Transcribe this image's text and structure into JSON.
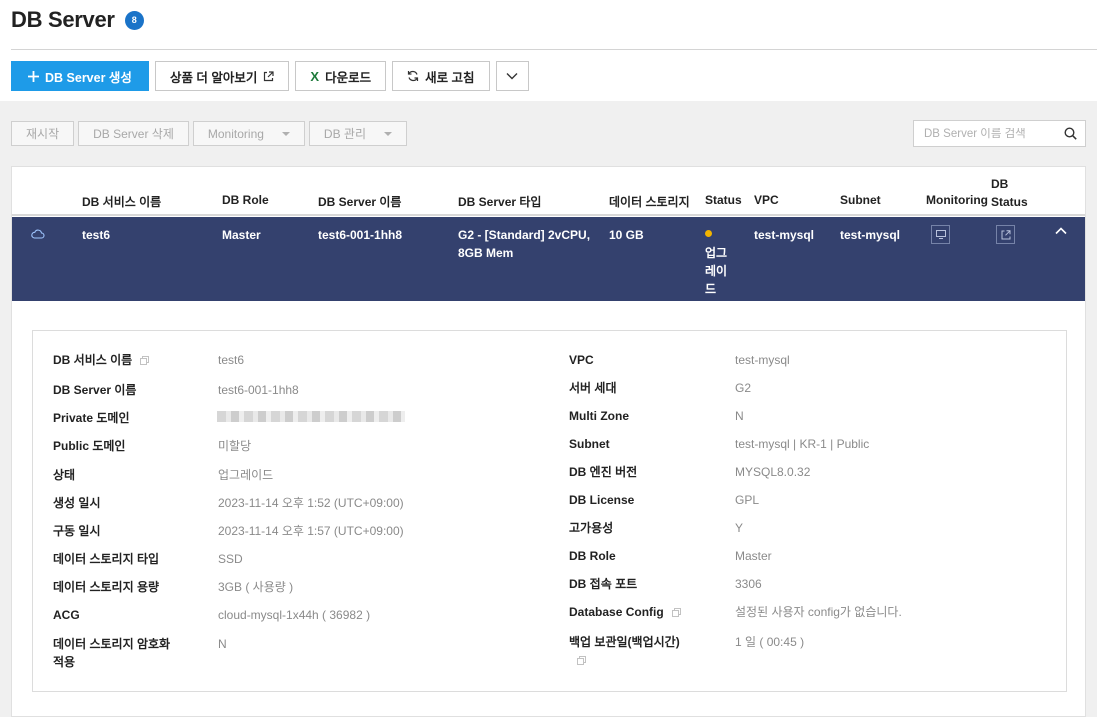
{
  "header": {
    "title": "DB Server",
    "count": "8"
  },
  "toolbar": {
    "create_label": "DB Server 생성",
    "learn_more_label": "상품 더 알아보기",
    "download_label": "다운로드",
    "refresh_label": "새로 고침"
  },
  "actions": {
    "restart": "재시작",
    "delete": "DB Server 삭제",
    "monitoring": "Monitoring",
    "db_manage": "DB 관리"
  },
  "search": {
    "placeholder": "DB Server 이름 검색"
  },
  "table": {
    "headers": {
      "service_name": "DB 서비스 이름",
      "role": "DB Role",
      "server_name": "DB Server 이름",
      "server_type": "DB Server 타입",
      "storage": "데이터 스토리지",
      "status": "Status",
      "vpc": "VPC",
      "subnet": "Subnet",
      "monitoring": "Monitoring",
      "db_status_1": "DB",
      "db_status_2": "Status"
    },
    "row": {
      "service_name": "test6",
      "role": "Master",
      "server_name": "test6-001-1hh8",
      "server_type_1": "G2 - [Standard] 2vCPU,",
      "server_type_2": "8GB Mem",
      "storage": "10 GB",
      "status_1": "업그",
      "status_2": "레이",
      "status_3": "드",
      "vpc": "test-mysql",
      "subnet": "test-mysql",
      "status_color": "#f2b400"
    }
  },
  "detail": {
    "left": [
      {
        "label": "DB 서비스 이름",
        "value": "test6"
      },
      {
        "label": "DB Server 이름",
        "value": "test6-001-1hh8"
      },
      {
        "label": "Private 도메인",
        "value": ""
      },
      {
        "label": "Public 도메인",
        "value": "미할당"
      },
      {
        "label": "상태",
        "value": "업그레이드"
      },
      {
        "label": "생성 일시",
        "value": "2023-11-14 오후 1:52 (UTC+09:00)"
      },
      {
        "label": "구동 일시",
        "value": "2023-11-14 오후 1:57 (UTC+09:00)"
      },
      {
        "label": "데이터 스토리지 타입",
        "value": "SSD"
      },
      {
        "label": "데이터 스토리지 용량",
        "value": "3GB ( 사용량 )"
      },
      {
        "label": "ACG",
        "value": "cloud-mysql-1x44h ( 36982 )"
      },
      {
        "label_1": "데이터 스토리지 암호화",
        "label_2": "적용",
        "value": "N"
      }
    ],
    "right": [
      {
        "label": "VPC",
        "value": "test-mysql"
      },
      {
        "label": "서버 세대",
        "value": "G2"
      },
      {
        "label": "Multi Zone",
        "value": "N"
      },
      {
        "label": "Subnet",
        "value": "test-mysql | KR-1 | Public"
      },
      {
        "label": "DB 엔진 버전",
        "value": "MYSQL8.0.32"
      },
      {
        "label": "DB License",
        "value": "GPL"
      },
      {
        "label": "고가용성",
        "value": "Y"
      },
      {
        "label": "DB Role",
        "value": "Master"
      },
      {
        "label": "DB 접속 포트",
        "value": "3306"
      },
      {
        "label": "Database Config",
        "value": "설정된 사용자 config가 없습니다."
      },
      {
        "label": "백업 보관일(백업시간)",
        "value": "1 일 ( 00:45 )"
      }
    ]
  },
  "colors": {
    "primary": "#1e9be8",
    "row_selected": "#34416e",
    "badge": "#1a73c8"
  }
}
